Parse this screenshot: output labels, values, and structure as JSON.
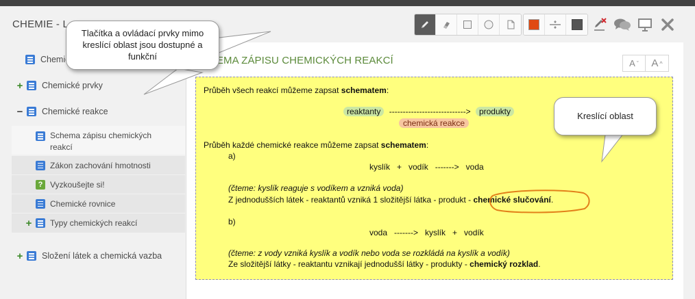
{
  "app": {
    "title": "CHEMIE - L"
  },
  "toolbar": {
    "tools": [
      {
        "name": "pencil",
        "icon": "pencil-icon",
        "active": true
      },
      {
        "name": "eraser",
        "icon": "eraser-icon",
        "active": false
      },
      {
        "name": "rectangle",
        "icon": "rectangle-icon",
        "active": false
      },
      {
        "name": "circle",
        "icon": "circle-icon",
        "active": false
      },
      {
        "name": "text",
        "icon": "page-icon",
        "active": false
      }
    ],
    "color": "#e04a12",
    "fill_color": "#555555",
    "actions": [
      "clear-drawing-icon",
      "comments-icon",
      "presentation-icon",
      "close-icon"
    ]
  },
  "sidebar": {
    "items": [
      {
        "label": "Chemie",
        "toggle": ""
      },
      {
        "label": "Chemické prvky",
        "toggle": "+"
      },
      {
        "label": "Chemické reakce",
        "toggle": "−"
      },
      {
        "label": "Schema zápisu chemických reakcí",
        "line1": "Schema zápisu chemických",
        "line2": "reakcí"
      },
      {
        "label": "Zákon zachování hmotnosti"
      },
      {
        "label": "Vyzkoušejte si!"
      },
      {
        "label": "Chemické rovnice"
      },
      {
        "label": "Typy chemických reakcí",
        "toggle": "+"
      },
      {
        "label": "Složení látek a chemická vazba",
        "toggle": "+"
      }
    ]
  },
  "content": {
    "title": "SCHEMA ZÁPISU CHEMICKÝCH REAKCÍ",
    "title_visible": "HEMA ZÁPISU CHEMICKÝCH REAKCÍ",
    "font_down": "A",
    "font_up": "A"
  },
  "drawing": {
    "line1_prefix": "Průběh všech reakcí můžeme zapsat ",
    "line1_bold": "schematem",
    "line1_suffix": ":",
    "reactants": "reaktanty",
    "arrow": "---------------------------->",
    "products": "produkty",
    "reaction": "chemická reakce",
    "line2_prefix": "Průběh každé chemické reakce můžeme zapsat ",
    "line2_bold": "schematem",
    "line2_suffix": ":",
    "a_label": "a)",
    "a_equation": "kyslík   +   vodík   ------->   voda",
    "a_note": "(čteme: kyslík reaguje s vodíkem a vzniká voda)",
    "a_text": "Z jednodušších látek - reaktantů vzniká 1 složitější látka - produkt - ",
    "a_bold": "chemické slučování",
    "a_end": ".",
    "b_label": "b)",
    "b_equation": "voda   ------->   kyslík   +   vodík",
    "b_note": "(čteme: z vody vzniká kyslík a vodík nebo voda se rozkládá na kyslík a vodík)",
    "b_text": "Ze složitější látky - reaktantu vznikají jednodušší látky - produkty - ",
    "b_bold": "chemický rozklad",
    "b_end": "."
  },
  "callouts": {
    "left": "Tlačítka a ovládací prvky mimo kreslící oblast jsou dostupné a funkční",
    "right": "Kreslící oblast"
  }
}
